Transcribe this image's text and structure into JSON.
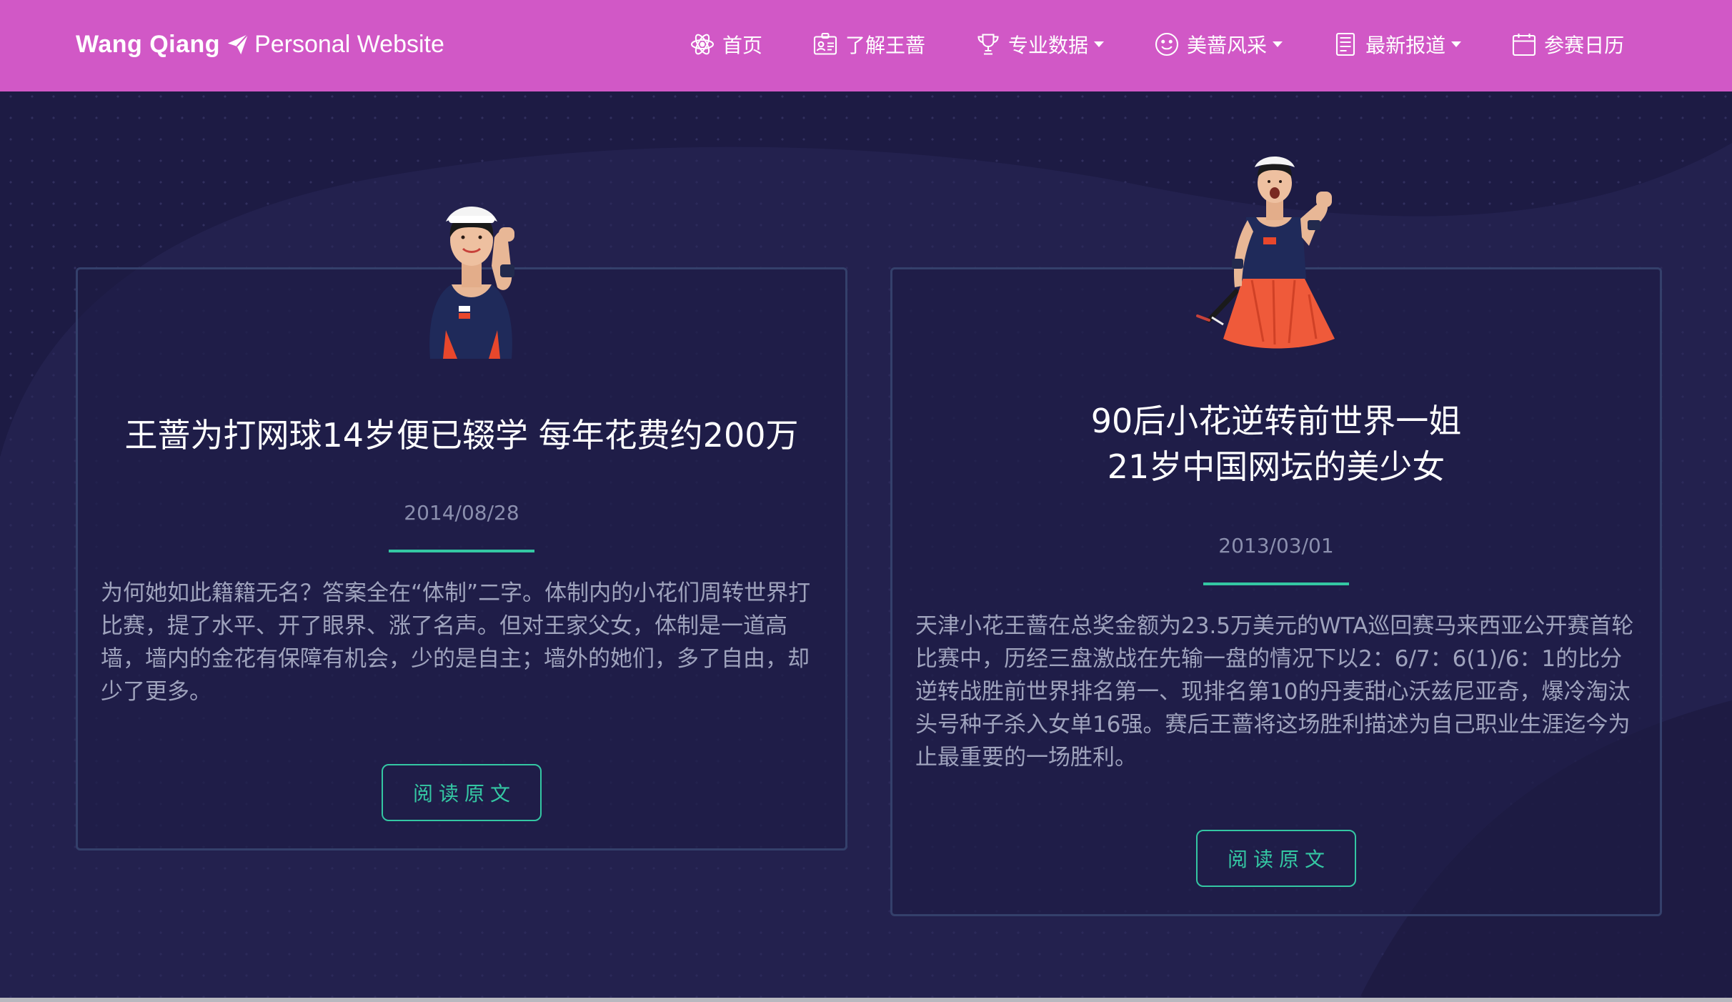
{
  "brand": {
    "name": "Wang Qiang",
    "subtitle": "Personal Website"
  },
  "nav": {
    "items": [
      {
        "label": "首页",
        "icon": "atom-icon",
        "dropdown": false
      },
      {
        "label": "了解王蔷",
        "icon": "id-card-icon",
        "dropdown": false
      },
      {
        "label": "专业数据",
        "icon": "trophy-icon",
        "dropdown": true
      },
      {
        "label": "美蔷风采",
        "icon": "smile-icon",
        "dropdown": true
      },
      {
        "label": "最新报道",
        "icon": "document-icon",
        "dropdown": true
      },
      {
        "label": "参赛日历",
        "icon": "calendar-icon",
        "dropdown": false
      }
    ]
  },
  "articles": [
    {
      "title_lines": [
        "王蔷为打网球14岁便已辍学 每年花费约200万"
      ],
      "date": "2014/08/28",
      "text": "为何她如此籍籍无名？答案全在“体制”二字。体制内的小花们周转世界打比赛，提了水平、开了眼界、涨了名声。但对王家父女，体制是一道高墙，墙内的金花有保障有机会，少的是自主；墙外的她们，多了自由，却少了更多。",
      "button": "阅读原文"
    },
    {
      "title_lines": [
        "90后小花逆转前世界一姐",
        "21岁中国网坛的美少女"
      ],
      "date": "2013/03/01",
      "text": "天津小花王蔷在总奖金额为23.5万美元的WTA巡回赛马来西亚公开赛首轮比赛中，历经三盘激战在先输一盘的情况下以2：6/7：6(1)/6：1的比分逆转战胜前世界排名第一、现排名第10的丹麦甜心沃兹尼亚奇，爆冷淘汰头号种子杀入女单16强。赛后王蔷将这场胜利描述为自己职业生涯迄今为止最重要的一场胜利。",
      "button": "阅读原文"
    }
  ],
  "colors": {
    "navbar": "#d158c6",
    "background": "#1d1b44",
    "accent": "#34c7a3",
    "card_border": "#34406b"
  }
}
